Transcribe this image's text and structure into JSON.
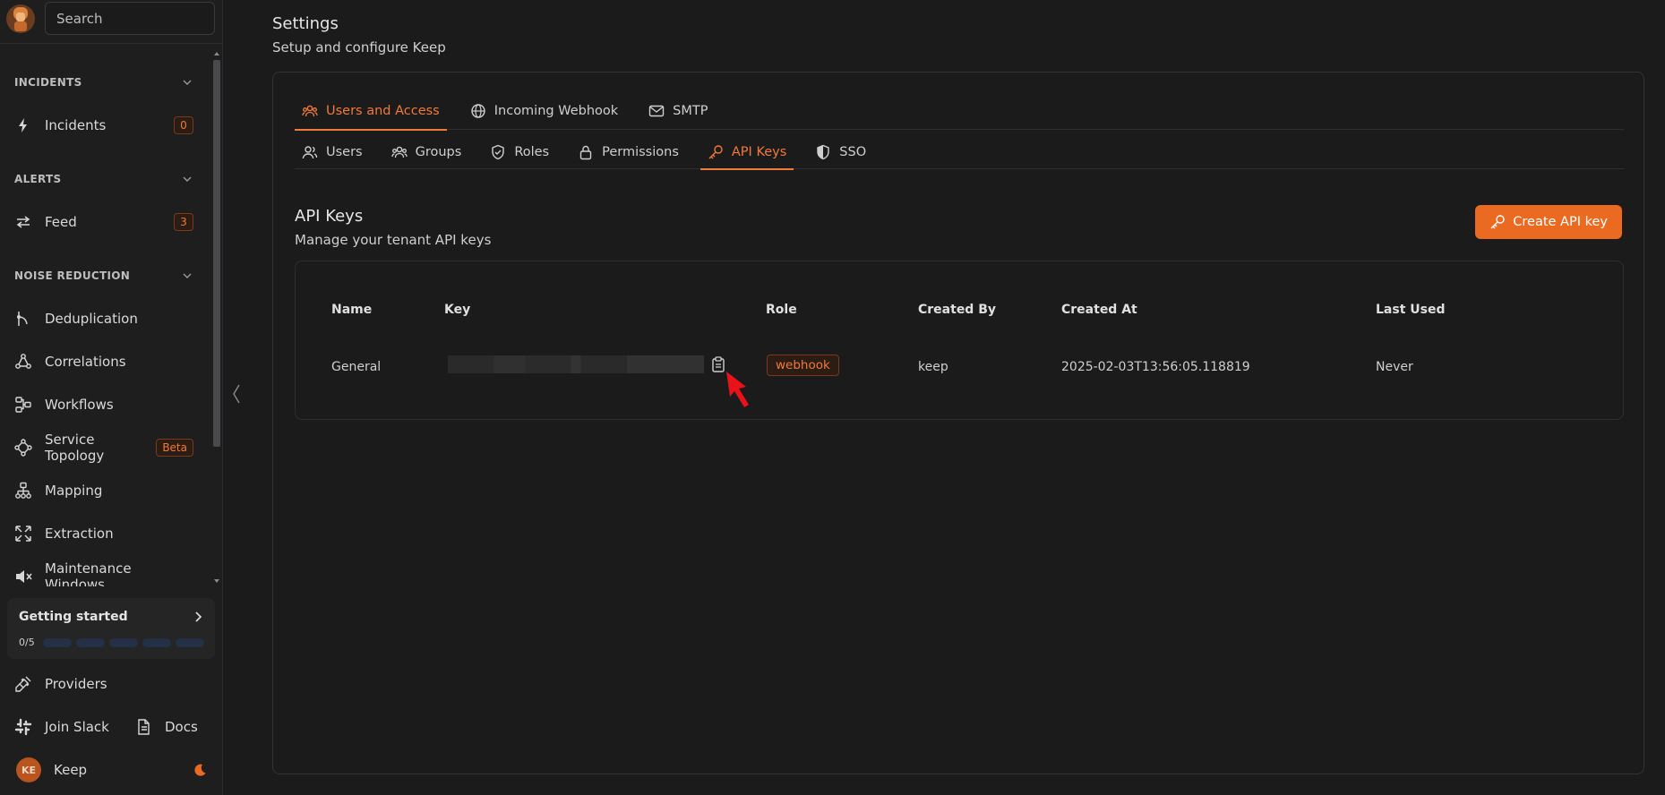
{
  "sidebar": {
    "search_placeholder": "Search",
    "sections": {
      "incidents": "INCIDENTS",
      "alerts": "ALERTS",
      "noise": "NOISE REDUCTION"
    },
    "items": {
      "incidents": {
        "label": "Incidents",
        "count": "0"
      },
      "feed": {
        "label": "Feed",
        "count": "3"
      },
      "deduplication": {
        "label": "Deduplication"
      },
      "correlations": {
        "label": "Correlations"
      },
      "workflows": {
        "label": "Workflows"
      },
      "topology": {
        "label": "Service Topology",
        "badge": "Beta"
      },
      "mapping": {
        "label": "Mapping"
      },
      "extraction": {
        "label": "Extraction"
      },
      "maintenance": {
        "label": "Maintenance Windows"
      }
    },
    "getting_started": {
      "title": "Getting started",
      "progress": "0/5",
      "steps_total": 5,
      "steps_done": 0
    },
    "providers": "Providers",
    "join_slack": "Join Slack",
    "docs": "Docs",
    "user": {
      "initials": "KE",
      "name": "Keep"
    }
  },
  "header": {
    "title": "Settings",
    "subtitle": "Setup and configure Keep"
  },
  "tabs_main": [
    {
      "label": "Users and Access",
      "icon": "users-group-icon",
      "active": true
    },
    {
      "label": "Incoming Webhook",
      "icon": "globe-icon",
      "active": false
    },
    {
      "label": "SMTP",
      "icon": "mail-icon",
      "active": false
    }
  ],
  "tabs_sub": [
    {
      "label": "Users",
      "icon": "users-icon",
      "active": false
    },
    {
      "label": "Groups",
      "icon": "groups-icon",
      "active": false
    },
    {
      "label": "Roles",
      "icon": "shield-check-icon",
      "active": false
    },
    {
      "label": "Permissions",
      "icon": "lock-icon",
      "active": false
    },
    {
      "label": "API Keys",
      "icon": "key-icon",
      "active": true
    },
    {
      "label": "SSO",
      "icon": "shield-half-icon",
      "active": false
    }
  ],
  "api_keys": {
    "title": "API Keys",
    "subtitle": "Manage your tenant API keys",
    "create_label": "Create API key",
    "columns": {
      "name": "Name",
      "key": "Key",
      "role": "Role",
      "created_by": "Created By",
      "created_at": "Created At",
      "last_used": "Last Used"
    },
    "rows": [
      {
        "name": "General",
        "role": "webhook",
        "created_by": "keep",
        "created_at": "2025-02-03T13:56:05.118819",
        "last_used": "Never"
      }
    ]
  },
  "colors": {
    "accent": "#ea6a22",
    "background": "#1b1b1c",
    "sidebar": "#1e1e1f"
  }
}
